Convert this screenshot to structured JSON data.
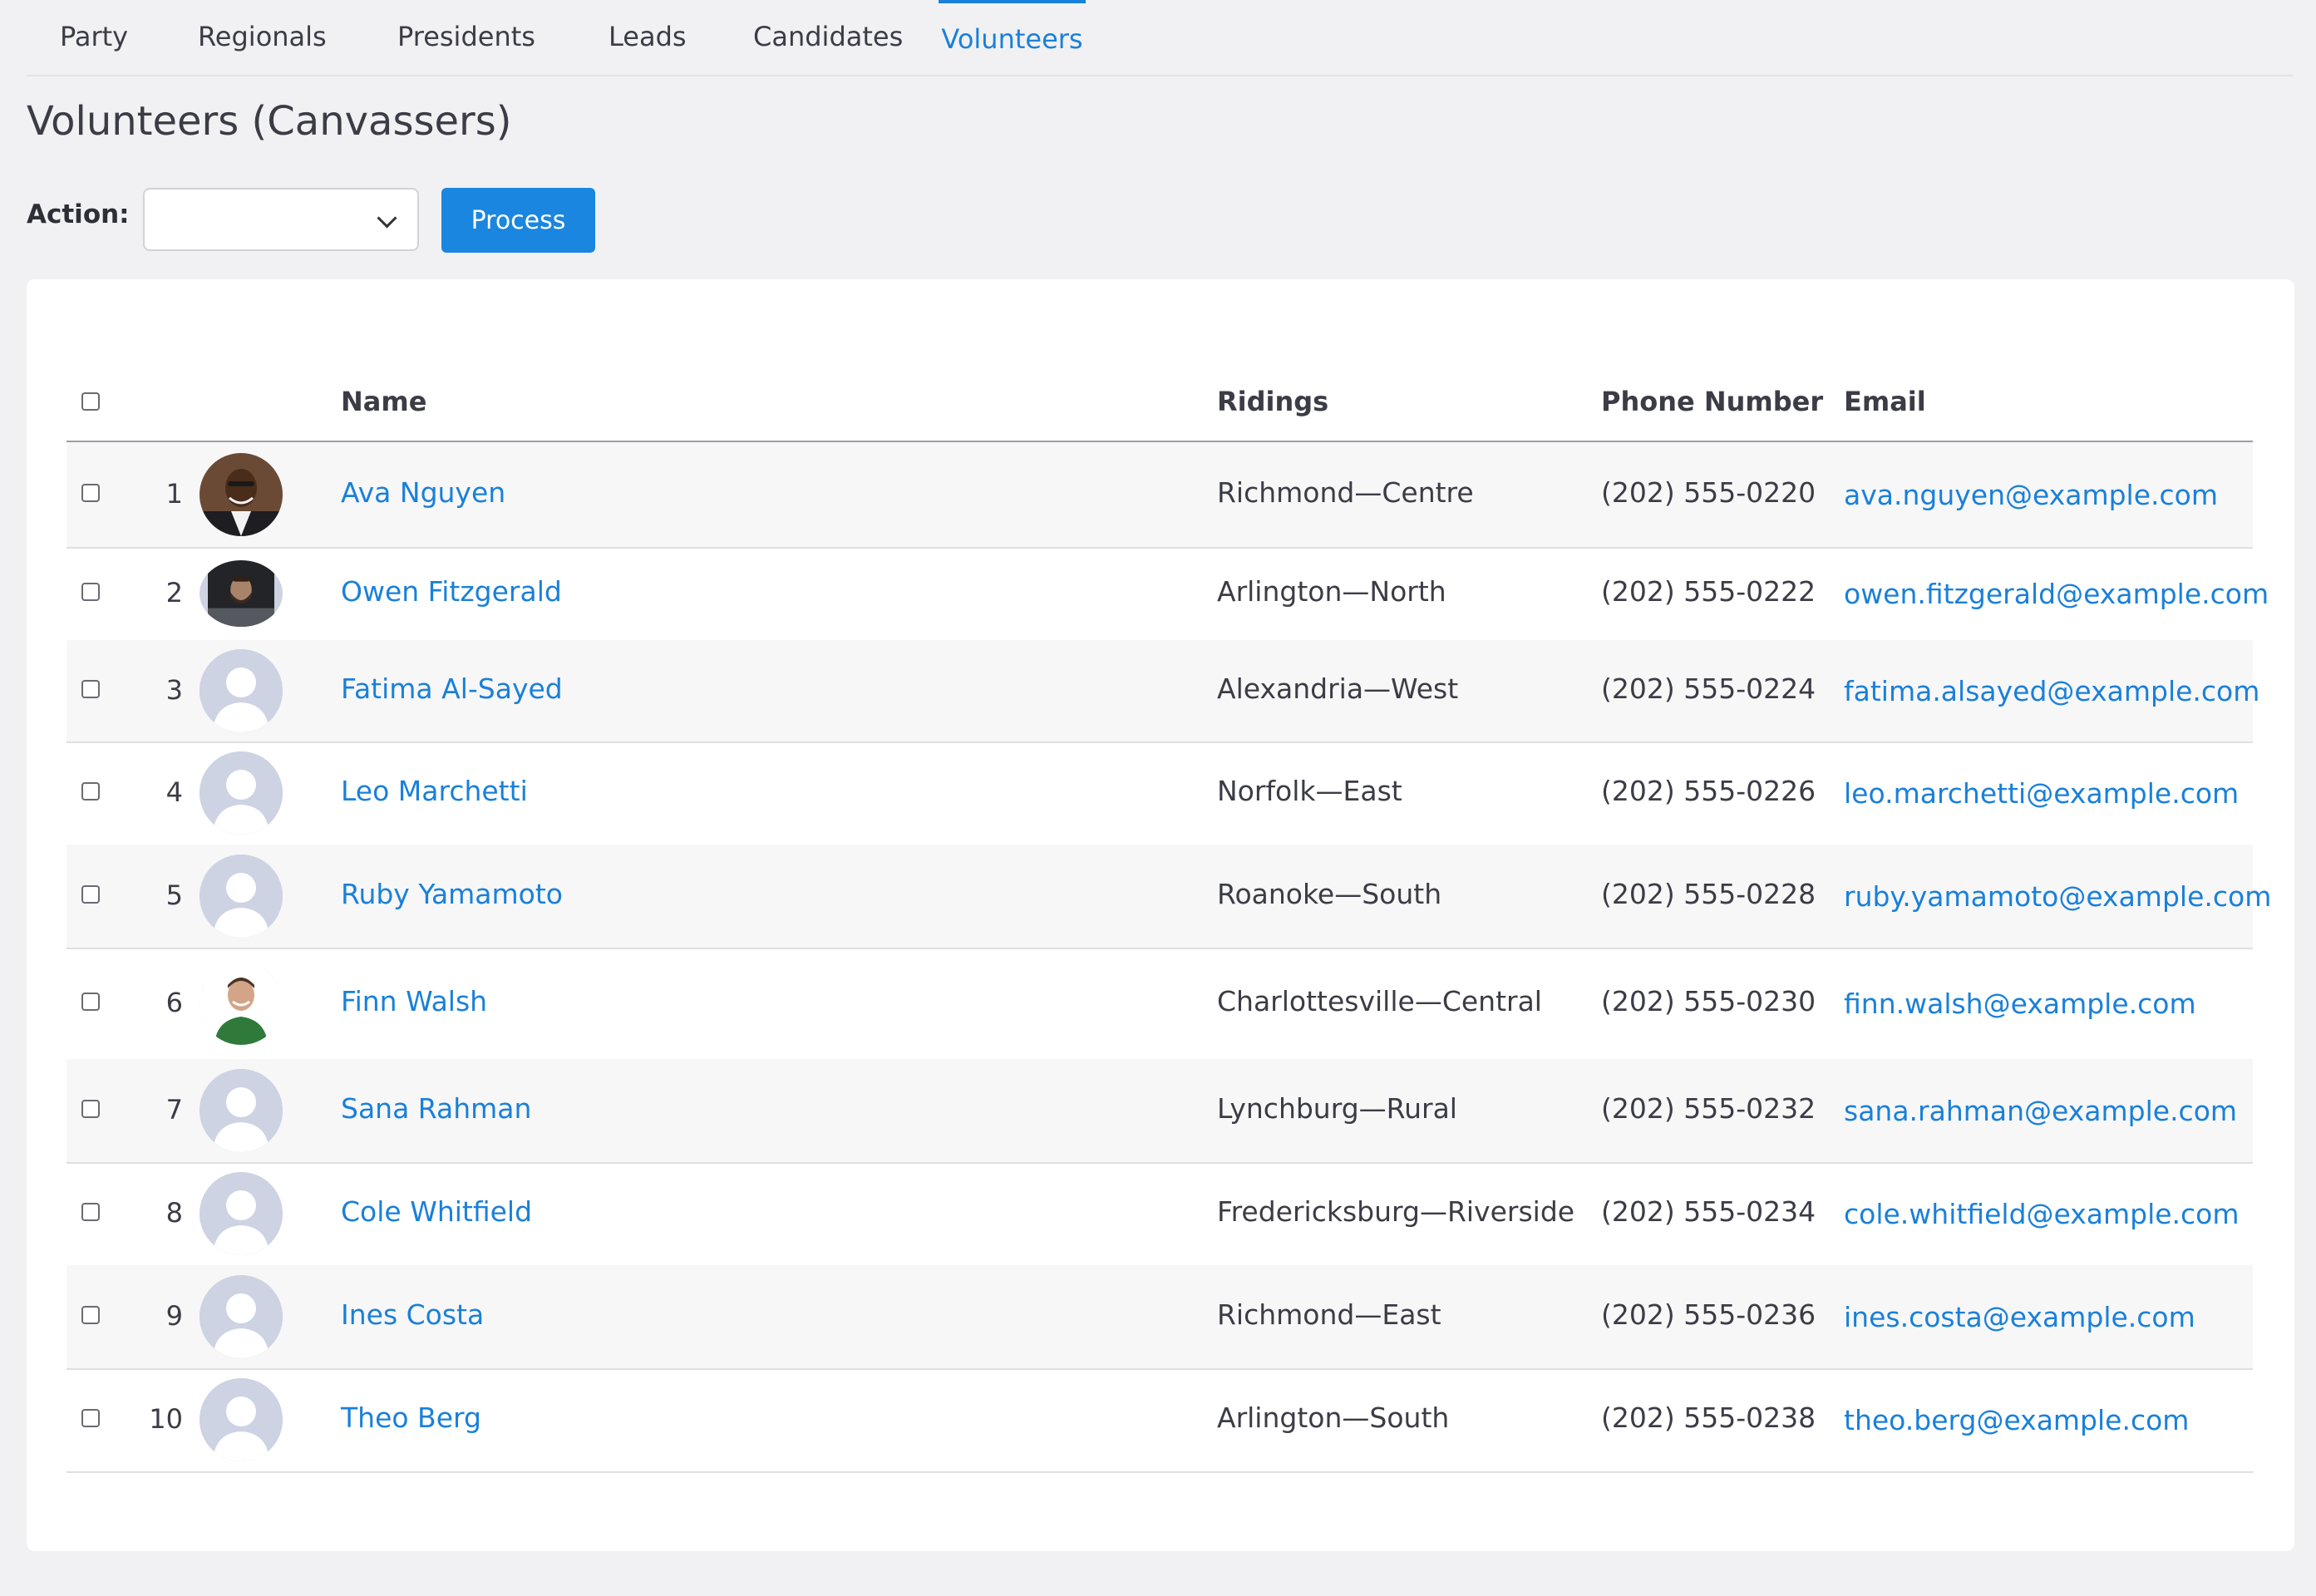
{
  "tabs": [
    {
      "label": "Party"
    },
    {
      "label": "Regionals"
    },
    {
      "label": "Presidents"
    },
    {
      "label": "Leads"
    },
    {
      "label": "Candidates"
    },
    {
      "label": "Volunteers",
      "active": true
    }
  ],
  "page_title": "Volunteers (Canvassers)",
  "action": {
    "label": "Action:",
    "selected": "",
    "button_label": "Process"
  },
  "table": {
    "columns": [
      "Name",
      "Ridings",
      "Phone Number",
      "Email"
    ],
    "rows": [
      {
        "num": "1",
        "name": "Ava Nguyen",
        "riding": "Richmond—Centre",
        "phone": "(202) 555-0220",
        "email": "ava.nguyen@example.com",
        "avatar": "photo-man-dark"
      },
      {
        "num": "2",
        "name": "Owen Fitzgerald",
        "riding": "Arlington—North",
        "phone": "(202) 555-0222",
        "email": "owen.fitzgerald@example.com",
        "avatar": "photo-man-beard"
      },
      {
        "num": "3",
        "name": "Fatima Al-Sayed",
        "riding": "Alexandria—West",
        "phone": "(202) 555-0224",
        "email": "fatima.alsayed@example.com",
        "avatar": "placeholder"
      },
      {
        "num": "4",
        "name": "Leo Marchetti",
        "riding": "Norfolk—East",
        "phone": "(202) 555-0226",
        "email": "leo.marchetti@example.com",
        "avatar": "placeholder"
      },
      {
        "num": "5",
        "name": "Ruby Yamamoto",
        "riding": "Roanoke—South",
        "phone": "(202) 555-0228",
        "email": "ruby.yamamoto@example.com",
        "avatar": "placeholder"
      },
      {
        "num": "6",
        "name": "Finn Walsh",
        "riding": "Charlottesville—Central",
        "phone": "(202) 555-0230",
        "email": "finn.walsh@example.com",
        "avatar": "photo-man-green"
      },
      {
        "num": "7",
        "name": "Sana Rahman",
        "riding": "Lynchburg—Rural",
        "phone": "(202) 555-0232",
        "email": "sana.rahman@example.com",
        "avatar": "placeholder"
      },
      {
        "num": "8",
        "name": "Cole Whitfield",
        "riding": "Fredericksburg—Riverside",
        "phone": "(202) 555-0234",
        "email": "cole.whitfield@example.com",
        "avatar": "placeholder"
      },
      {
        "num": "9",
        "name": "Ines Costa",
        "riding": "Richmond—East",
        "phone": "(202) 555-0236",
        "email": "ines.costa@example.com",
        "avatar": "placeholder"
      },
      {
        "num": "10",
        "name": "Theo Berg",
        "riding": "Arlington—South",
        "phone": "(202) 555-0238",
        "email": "theo.berg@example.com",
        "avatar": "placeholder"
      }
    ]
  },
  "colors": {
    "accent": "#1a80d9",
    "button": "#1a86e0",
    "placeholder_avatar": "#ced3e3"
  }
}
